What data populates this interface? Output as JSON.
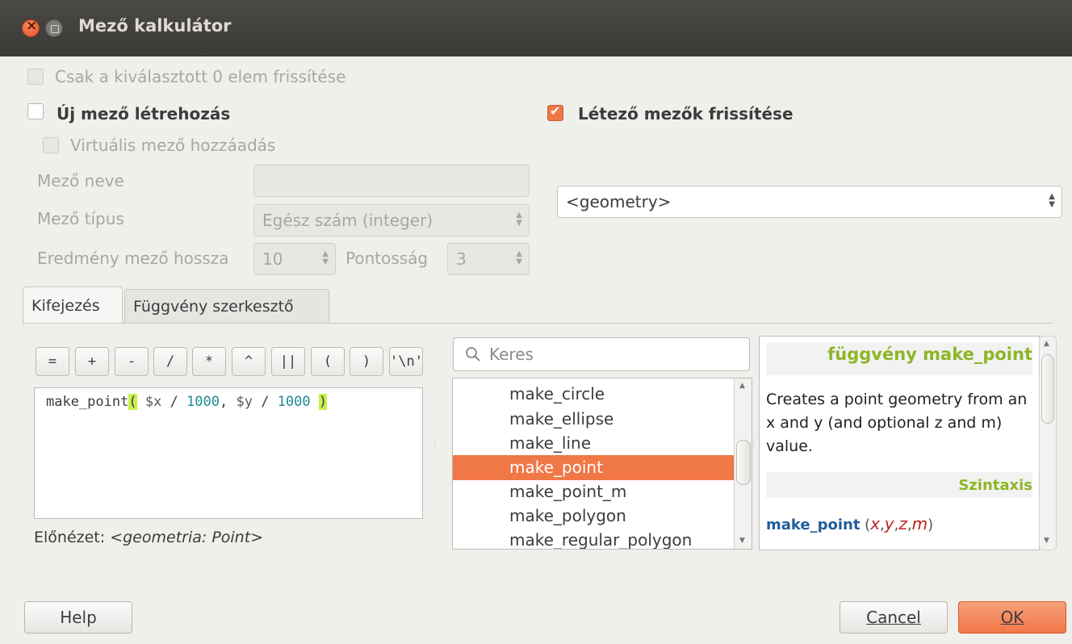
{
  "window": {
    "title": "Mező kalkulátor"
  },
  "options": {
    "only_selected": "Csak a kiválasztott 0 elem frissítése",
    "create_new_field": "Új mező létrehozás",
    "virtual_field": "Virtuális mező hozzáadás",
    "update_existing": "Létező mezők frissítése",
    "update_existing_checked": true,
    "create_new_checked": false
  },
  "new_field": {
    "name_label": "Mező neve",
    "name_value": "",
    "type_label": "Mező típus",
    "type_value": "Egész szám (integer)",
    "length_label": "Eredmény mező hossza",
    "length_value": "10",
    "precision_label": "Pontosság",
    "precision_value": "3"
  },
  "existing_field": {
    "selected": "<geometry>"
  },
  "tabs": [
    {
      "label": "Kifejezés",
      "active": true
    },
    {
      "label": "Függvény szerkesztő",
      "active": false
    }
  ],
  "operators": [
    "=",
    "+",
    "-",
    "/",
    "*",
    "^",
    "||",
    "(",
    ")",
    "'\\n'"
  ],
  "expression": {
    "fn": "make_point",
    "open": "(",
    "arg1_var": " $x",
    "arg1_op": " / ",
    "arg1_num": "1000",
    "sep": ", ",
    "arg2_var": "$y",
    "arg2_op": " / ",
    "arg2_num": "1000",
    "close_space": " ",
    "close": ")"
  },
  "preview": {
    "label": "Előnézet:",
    "value": "<geometria: Point>"
  },
  "search": {
    "placeholder": "Keres"
  },
  "function_list": {
    "items": [
      "make_circle",
      "make_ellipse",
      "make_line",
      "make_point",
      "make_point_m",
      "make_polygon",
      "make_regular_polygon"
    ],
    "selected_index": 3
  },
  "help": {
    "title": "függvény make_point",
    "description": "Creates a point geometry from an x and y (and optional z and m) value.",
    "syntax_heading": "Szintaxis",
    "syntax_fn": "make_point",
    "syntax_open": "(",
    "syntax_args": [
      "x",
      "y",
      "z",
      "m"
    ],
    "syntax_sep": ",",
    "syntax_close": ")"
  },
  "buttons": {
    "help": "Help",
    "cancel": "Cancel",
    "ok": "OK"
  },
  "colors": {
    "accent": "#f07746",
    "help_heading": "#8db626",
    "number": "#1e8a93",
    "bracket_highlight": "#c5f04a"
  },
  "icons": {
    "search": "search-icon",
    "close": "close-icon",
    "minimize": "minimize-icon"
  }
}
